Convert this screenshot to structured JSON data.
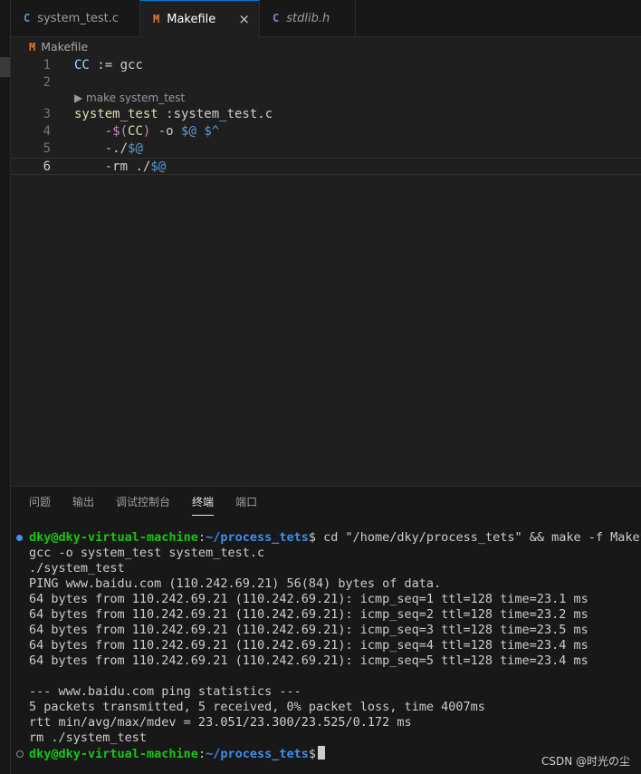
{
  "tabs": [
    {
      "icon": "C",
      "label": "system_test.c",
      "active": false,
      "italic": false
    },
    {
      "icon": "M",
      "label": "Makefile",
      "active": true,
      "italic": false,
      "close": "×"
    },
    {
      "icon": "C",
      "label": "stdlib.h",
      "active": false,
      "italic": true
    }
  ],
  "breadcrumb": {
    "icon": "M",
    "label": "Makefile"
  },
  "editor": {
    "lines": [
      {
        "n": "1",
        "text": "CC := gcc"
      },
      {
        "n": "2",
        "text": ""
      },
      {
        "n": "3",
        "text": "system_test :system_test.c"
      },
      {
        "n": "4",
        "text": "\t-$(CC) -o $@ $^"
      },
      {
        "n": "5",
        "text": "\t-./$@"
      },
      {
        "n": "6",
        "text": "\t-rm ./$@"
      }
    ],
    "codelens": "▶ make system_test",
    "current_line": "6"
  },
  "panel": {
    "tabs": [
      "问题",
      "输出",
      "调试控制台",
      "终端",
      "端口"
    ],
    "active_tab": "终端"
  },
  "terminal": {
    "prompt_user": "dky@dky-virtual-machine",
    "prompt_sep": ":",
    "prompt_path": "~/process_tets",
    "prompt_dollar": "$",
    "command": " cd \"/home/dky/process_tets\" && make -f Makefile",
    "output": [
      "gcc -o system_test system_test.c",
      "./system_test",
      "PING www.baidu.com (110.242.69.21) 56(84) bytes of data.",
      "64 bytes from 110.242.69.21 (110.242.69.21): icmp_seq=1 ttl=128 time=23.1 ms",
      "64 bytes from 110.242.69.21 (110.242.69.21): icmp_seq=2 ttl=128 time=23.2 ms",
      "64 bytes from 110.242.69.21 (110.242.69.21): icmp_seq=3 ttl=128 time=23.5 ms",
      "64 bytes from 110.242.69.21 (110.242.69.21): icmp_seq=4 ttl=128 time=23.4 ms",
      "64 bytes from 110.242.69.21 (110.242.69.21): icmp_seq=5 ttl=128 time=23.4 ms",
      "",
      "--- www.baidu.com ping statistics ---",
      "5 packets transmitted, 5 received, 0% packet loss, time 4007ms",
      "rtt min/avg/max/mdev = 23.051/23.300/23.525/0.172 ms",
      "rm ./system_test"
    ]
  },
  "watermark": "CSDN @时光の尘",
  "colors": {
    "accent": "#0078d4",
    "prompt_user": "#16c60c",
    "prompt_path": "#3b8eea",
    "makefile_icon": "#e37933",
    "c_icon": "#519aba"
  }
}
